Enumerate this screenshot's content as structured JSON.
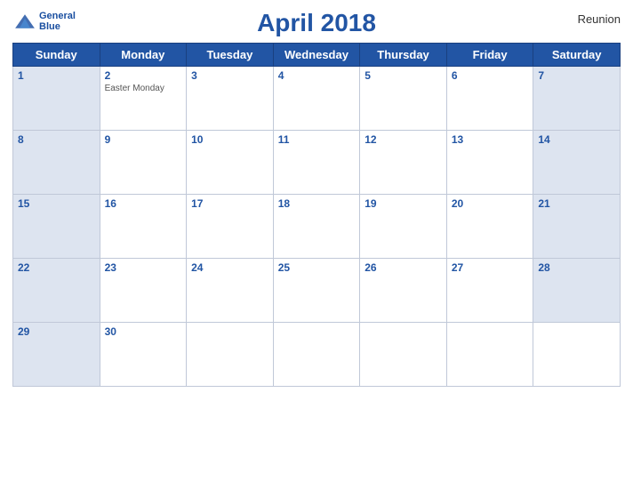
{
  "header": {
    "title": "April 2018",
    "region": "Reunion",
    "logo_line1": "General",
    "logo_line2": "Blue"
  },
  "weekdays": [
    "Sunday",
    "Monday",
    "Tuesday",
    "Wednesday",
    "Thursday",
    "Friday",
    "Saturday"
  ],
  "weeks": [
    [
      {
        "day": 1,
        "type": "sunday",
        "holiday": ""
      },
      {
        "day": 2,
        "type": "weekday",
        "holiday": "Easter Monday"
      },
      {
        "day": 3,
        "type": "weekday",
        "holiday": ""
      },
      {
        "day": 4,
        "type": "weekday",
        "holiday": ""
      },
      {
        "day": 5,
        "type": "weekday",
        "holiday": ""
      },
      {
        "day": 6,
        "type": "weekday",
        "holiday": ""
      },
      {
        "day": 7,
        "type": "saturday",
        "holiday": ""
      }
    ],
    [
      {
        "day": 8,
        "type": "sunday",
        "holiday": ""
      },
      {
        "day": 9,
        "type": "weekday",
        "holiday": ""
      },
      {
        "day": 10,
        "type": "weekday",
        "holiday": ""
      },
      {
        "day": 11,
        "type": "weekday",
        "holiday": ""
      },
      {
        "day": 12,
        "type": "weekday",
        "holiday": ""
      },
      {
        "day": 13,
        "type": "weekday",
        "holiday": ""
      },
      {
        "day": 14,
        "type": "saturday",
        "holiday": ""
      }
    ],
    [
      {
        "day": 15,
        "type": "sunday",
        "holiday": ""
      },
      {
        "day": 16,
        "type": "weekday",
        "holiday": ""
      },
      {
        "day": 17,
        "type": "weekday",
        "holiday": ""
      },
      {
        "day": 18,
        "type": "weekday",
        "holiday": ""
      },
      {
        "day": 19,
        "type": "weekday",
        "holiday": ""
      },
      {
        "day": 20,
        "type": "weekday",
        "holiday": ""
      },
      {
        "day": 21,
        "type": "saturday",
        "holiday": ""
      }
    ],
    [
      {
        "day": 22,
        "type": "sunday",
        "holiday": ""
      },
      {
        "day": 23,
        "type": "weekday",
        "holiday": ""
      },
      {
        "day": 24,
        "type": "weekday",
        "holiday": ""
      },
      {
        "day": 25,
        "type": "weekday",
        "holiday": ""
      },
      {
        "day": 26,
        "type": "weekday",
        "holiday": ""
      },
      {
        "day": 27,
        "type": "weekday",
        "holiday": ""
      },
      {
        "day": 28,
        "type": "saturday",
        "holiday": ""
      }
    ],
    [
      {
        "day": 29,
        "type": "sunday",
        "holiday": ""
      },
      {
        "day": 30,
        "type": "weekday",
        "holiday": ""
      },
      {
        "day": null,
        "type": "empty",
        "holiday": ""
      },
      {
        "day": null,
        "type": "empty",
        "holiday": ""
      },
      {
        "day": null,
        "type": "empty",
        "holiday": ""
      },
      {
        "day": null,
        "type": "empty",
        "holiday": ""
      },
      {
        "day": null,
        "type": "empty",
        "holiday": ""
      }
    ]
  ]
}
